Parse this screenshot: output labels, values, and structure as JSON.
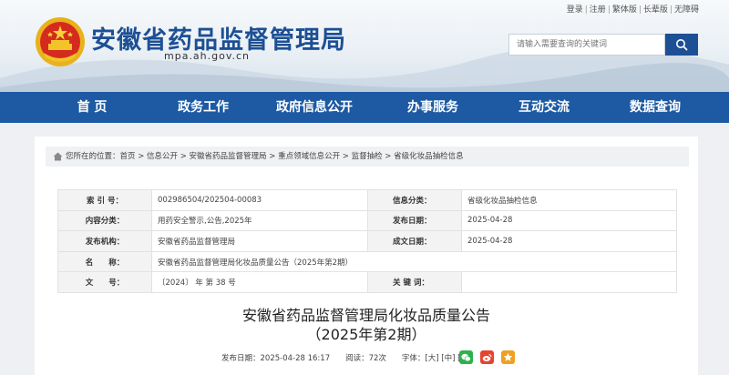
{
  "header": {
    "top_links": [
      "登录",
      "注册",
      "繁体版",
      "长辈版",
      "无障碍"
    ],
    "site_title": "安徽省药品监督管理局",
    "domain": "mpa.ah.gov.cn",
    "search_placeholder": "请输入需要查询的关键词",
    "emblem_icon": "national-emblem-icon",
    "search_icon": "search-icon"
  },
  "nav": [
    "首 页",
    "政务工作",
    "政府信息公开",
    "办事服务",
    "互动交流",
    "数据查询"
  ],
  "breadcrumb": "您所在的位置：首页 > 信息公开 > 安徽省药品监督管理局 > 重点领域信息公开 > 监督抽检 > 省级化妆品抽检信息",
  "meta": {
    "index_label": "索 引 号：",
    "index_value": "002986504/202504-00083",
    "category_label": "信息分类：",
    "category_value": "省级化妆品抽检信息",
    "content_label": "内容分类：",
    "content_value": "用药安全警示,公告,2025年",
    "pubdate_label": "发布日期：",
    "pubdate_value": "2025-04-28",
    "org_label": "发布机构：",
    "org_value": "安徽省药品监督管理局",
    "created_label": "成文日期：",
    "created_value": "2025-04-28",
    "name_label": "名　　称：",
    "name_value": "安徽省药品监督管理局化妆品质量公告（2025年第2期）",
    "docno_label": "文　　号：",
    "docno_value": "〔2024〕 年 第 38 号",
    "keywords_label": "关 键 词：",
    "keywords_value": ""
  },
  "article": {
    "title_line1": "安徽省药品监督管理局化妆品质量公告",
    "title_line2": "（2025年第2期）",
    "pubinfo": "发布日期：2025-04-28 16:17　　阅读：72次　　字体：[大] [中] [小]"
  },
  "share_icons": [
    "wechat-icon",
    "weibo-icon",
    "favorite-icon"
  ],
  "colors": {
    "brand": "#1d5aa3",
    "title": "#1d4f94",
    "wechat": "#2bb24c",
    "weibo": "#e6442f",
    "favorite": "#f0a020"
  }
}
